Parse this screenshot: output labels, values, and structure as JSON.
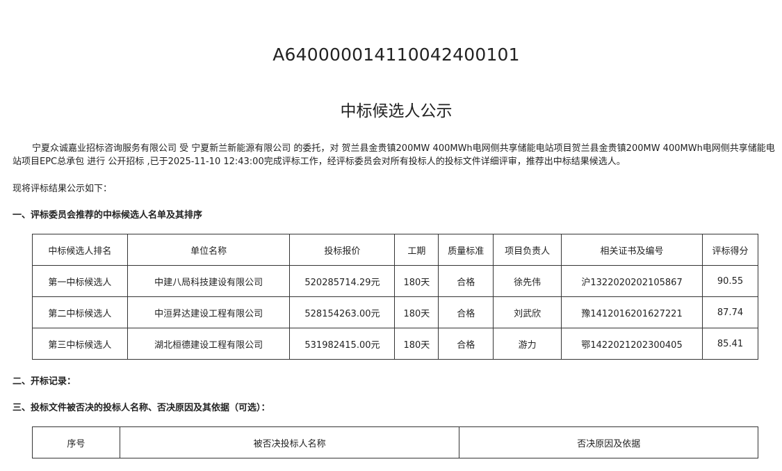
{
  "document": {
    "code": "A640000014110042400101",
    "title": "中标候选人公示",
    "intro": "宁夏众诚嘉业招标咨询服务有限公司 受 宁夏新兰新能源有限公司 的委托，对 贺兰县金贵镇200MW 400MWh电网侧共享储能电站项目贺兰县金贵镇200MW 400MWh电网侧共享储能电站项目EPC总承包 进行 公开招标 ,已于2025-11-10 12:43:00完成评标工作，经评标委员会对所有投标人的投标文件详细评审，推荐出中标结果候选人。",
    "lead": "现将评标结果公示如下："
  },
  "sections": {
    "s1": "一、评标委员会推荐的中标候选人名单及其排序",
    "s2": "二、开标记录：",
    "s3": "三、投标文件被否决的投标人名称、否决原因及其依据（可选）："
  },
  "candidates_table": {
    "headers": [
      "中标候选人排名",
      "单位名称",
      "投标报价",
      "工期",
      "质量标准",
      "项目负责人",
      "相关证书及编号",
      "评标得分"
    ],
    "rows": [
      [
        "第一中标候选人",
        "中建八局科技建设有限公司",
        "520285714.29元",
        "180天",
        "合格",
        "徐先伟",
        "沪1322020202105867",
        "90.55"
      ],
      [
        "第二中标候选人",
        "中洹昇达建设工程有限公司",
        "528154263.00元",
        "180天",
        "合格",
        "刘武欣",
        "豫1412016201627221",
        "87.74"
      ],
      [
        "第三中标候选人",
        "湖北桓德建设工程有限公司",
        "531982415.00元",
        "180天",
        "合格",
        "游力",
        "鄂1422021202300405",
        "85.41"
      ]
    ]
  },
  "rejected_table": {
    "headers": [
      "序号",
      "被否决投标人名称",
      "否决原因及依据"
    ]
  }
}
